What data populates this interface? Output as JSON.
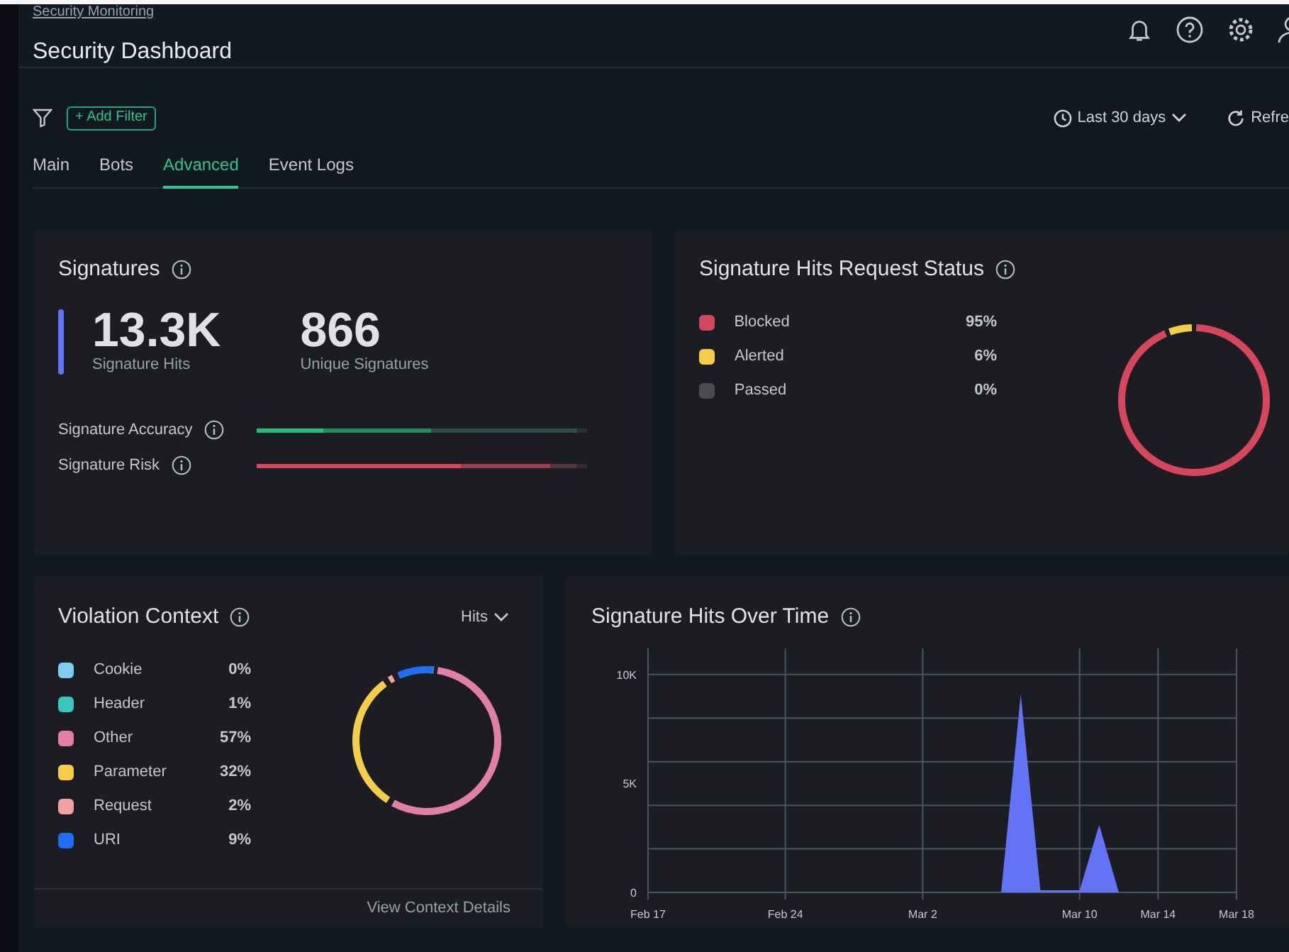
{
  "header": {
    "breadcrumb": "Security Monitoring",
    "title": "Security Dashboard"
  },
  "toolbar": {
    "add_filter": "+ Add Filter",
    "time_range": "Last 30 days",
    "refresh": "Refre"
  },
  "tabs": [
    {
      "label": "Main",
      "selected": false
    },
    {
      "label": "Bots",
      "selected": false
    },
    {
      "label": "Advanced",
      "selected": true
    },
    {
      "label": "Event Logs",
      "selected": false
    }
  ],
  "signatures": {
    "title": "Signatures",
    "stats": [
      {
        "value": "13.3K",
        "label": "Signature Hits"
      },
      {
        "value": "866",
        "label": "Unique Signatures"
      }
    ],
    "bars": [
      {
        "label": "Signature Accuracy",
        "color": "#1fbf75",
        "segments": [
          {
            "level": 0.2
          },
          {
            "level": 0.53
          },
          {
            "level": 0.97
          }
        ]
      },
      {
        "label": "Signature Risk",
        "color": "#d6465c",
        "segments": [
          {
            "level": 0.62
          },
          {
            "level": 0.89
          },
          {
            "level": 0.97
          }
        ]
      }
    ]
  },
  "request_status": {
    "title": "Signature Hits Request Status",
    "legend": [
      {
        "value": "95%",
        "color": "#d6465c"
      },
      {
        "value": "6%",
        "color": "#f5cd47"
      },
      {
        "value": "0%",
        "color": "#4a4c52"
      }
    ],
    "chart_data": {
      "type": "donut",
      "categories": [
        "Blocked",
        "Alerted",
        "Passed"
      ],
      "values": [
        95,
        6,
        0
      ]
    }
  },
  "violation_context": {
    "title": "Violation Context",
    "metric": "Hits",
    "legend": [
      {
        "label": "Cookie",
        "value": "0%",
        "color": "#7ccdf0"
      },
      {
        "label": "Header",
        "value": "1%",
        "color": "#38c6bd"
      },
      {
        "label": "Other",
        "value": "57%",
        "color": "#e27fa6"
      },
      {
        "label": "Parameter",
        "value": "32%",
        "color": "#f5cd47"
      },
      {
        "label": "Request",
        "value": "2%",
        "color": "#f0a1a1"
      },
      {
        "label": "URI",
        "value": "9%",
        "color": "#1f6ef5"
      }
    ],
    "footer_link": "View Context Details"
  },
  "hits_over_time": {
    "title": "Signature Hits Over Time",
    "chart_data": {
      "type": "area",
      "categories": [
        "Feb 17",
        null,
        null,
        null,
        null,
        null,
        null,
        "Feb 24",
        null,
        null,
        null,
        null,
        null,
        null,
        "Mar 2",
        null,
        null,
        null,
        null,
        null,
        null,
        null,
        "Mar 10",
        null,
        null,
        null,
        "Mar 14",
        null,
        null,
        null,
        "Mar 18"
      ],
      "series": [
        {
          "color": "#6273f5",
          "values": [
            0,
            0,
            0,
            0,
            0,
            0,
            0,
            0,
            0,
            0,
            0,
            0,
            0,
            0,
            0,
            0,
            0,
            0,
            0,
            9100,
            100,
            100,
            100,
            3100,
            0,
            0,
            0,
            0,
            0,
            0,
            0
          ]
        }
      ],
      "ylim": [
        0,
        11200
      ],
      "grid": true,
      "yticks": [
        {
          "value": 0,
          "label": "0"
        },
        {
          "value": 5000,
          "label": "5K"
        },
        {
          "value": 10000,
          "label": "10K"
        }
      ]
    }
  }
}
